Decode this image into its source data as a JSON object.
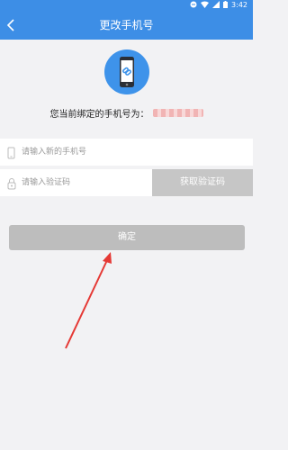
{
  "status_bar": {
    "time": "3:42"
  },
  "header": {
    "title": "更改手机号"
  },
  "bound_phone": {
    "label": "您当前绑定的手机号为："
  },
  "form": {
    "phone_placeholder": "请输入新的手机号",
    "code_placeholder": "请输入验证码",
    "get_code_label": "获取验证码"
  },
  "actions": {
    "confirm_label": "确定"
  },
  "colors": {
    "primary": "#3d8ee6",
    "disabled_button": "#bdbdbd",
    "annotation_arrow": "#e53935"
  }
}
